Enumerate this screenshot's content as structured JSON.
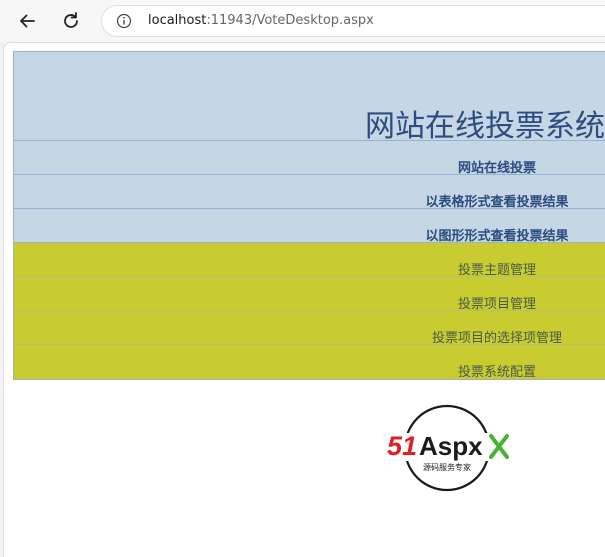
{
  "browser": {
    "url_host": "localhost",
    "url_rest": ":11943/VoteDesktop.aspx",
    "back_icon": "arrow-left-icon",
    "reload_icon": "reload-icon",
    "info_icon": "info-icon"
  },
  "page": {
    "title": "网站在线投票系统",
    "menu": [
      {
        "label": "网站在线投票",
        "style": "blue"
      },
      {
        "label": "以表格形式查看投票结果",
        "style": "blue"
      },
      {
        "label": "以图形形式查看投票结果",
        "style": "blue"
      },
      {
        "label": "投票主题管理",
        "style": "olive"
      },
      {
        "label": "投票项目管理",
        "style": "olive"
      },
      {
        "label": "投票项目的选择项管理",
        "style": "olive"
      },
      {
        "label": "投票系统配置",
        "style": "olive"
      }
    ]
  },
  "logo": {
    "number": "51",
    "brand": "Aspx",
    "tagline": "源码服务专家"
  },
  "colors": {
    "header_bg": "#c5d6e4",
    "olive_bg": "#c8cc31",
    "title": "#2d4d7e",
    "logo_red": "#e01e25",
    "logo_green": "#45b336"
  }
}
